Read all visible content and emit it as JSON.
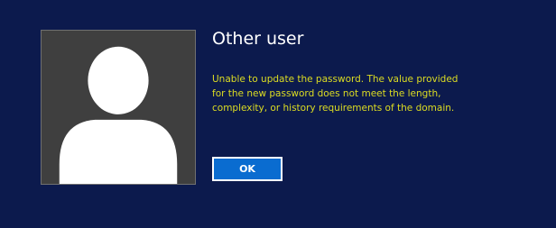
{
  "user": {
    "name": "Other user",
    "avatar_icon": "user-silhouette-icon"
  },
  "dialog": {
    "message": "Unable to update the password. The value provided for the new password does not meet the length, complexity, or history requirements of the domain.",
    "ok_label": "OK"
  },
  "colors": {
    "background": "#0c1a4d",
    "avatar_background": "#3f3f3f",
    "message_text": "#dcdc22",
    "button_background": "#0a6cd0"
  }
}
